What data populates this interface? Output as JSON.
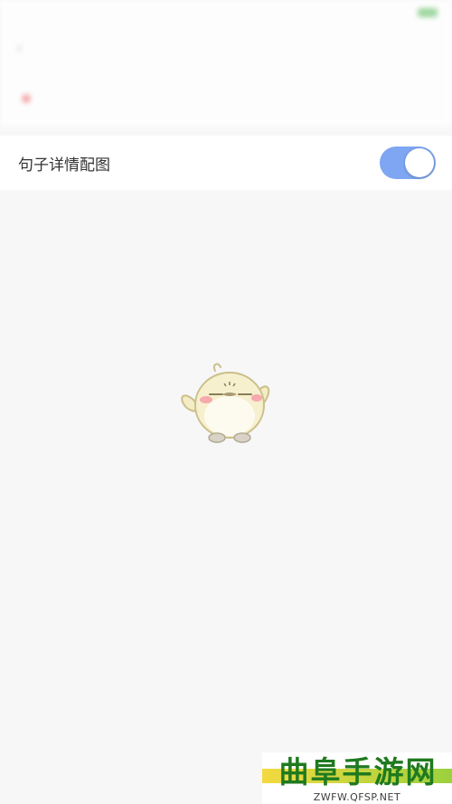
{
  "background_header": {
    "status_left": "",
    "status_center": "",
    "nav_title": "",
    "row_label": "",
    "row_value": ""
  },
  "settings": {
    "items": [
      {
        "label": "句子详情配图",
        "toggle_on": true
      }
    ]
  },
  "colors": {
    "toggle_accent": "#7ea6f2",
    "background": "#f7f7f8"
  },
  "loading": {
    "mascot": "chick-mascot-icon"
  },
  "watermark": {
    "title": "曲阜手游网",
    "url": "ZWFW.QFSP.NET"
  }
}
